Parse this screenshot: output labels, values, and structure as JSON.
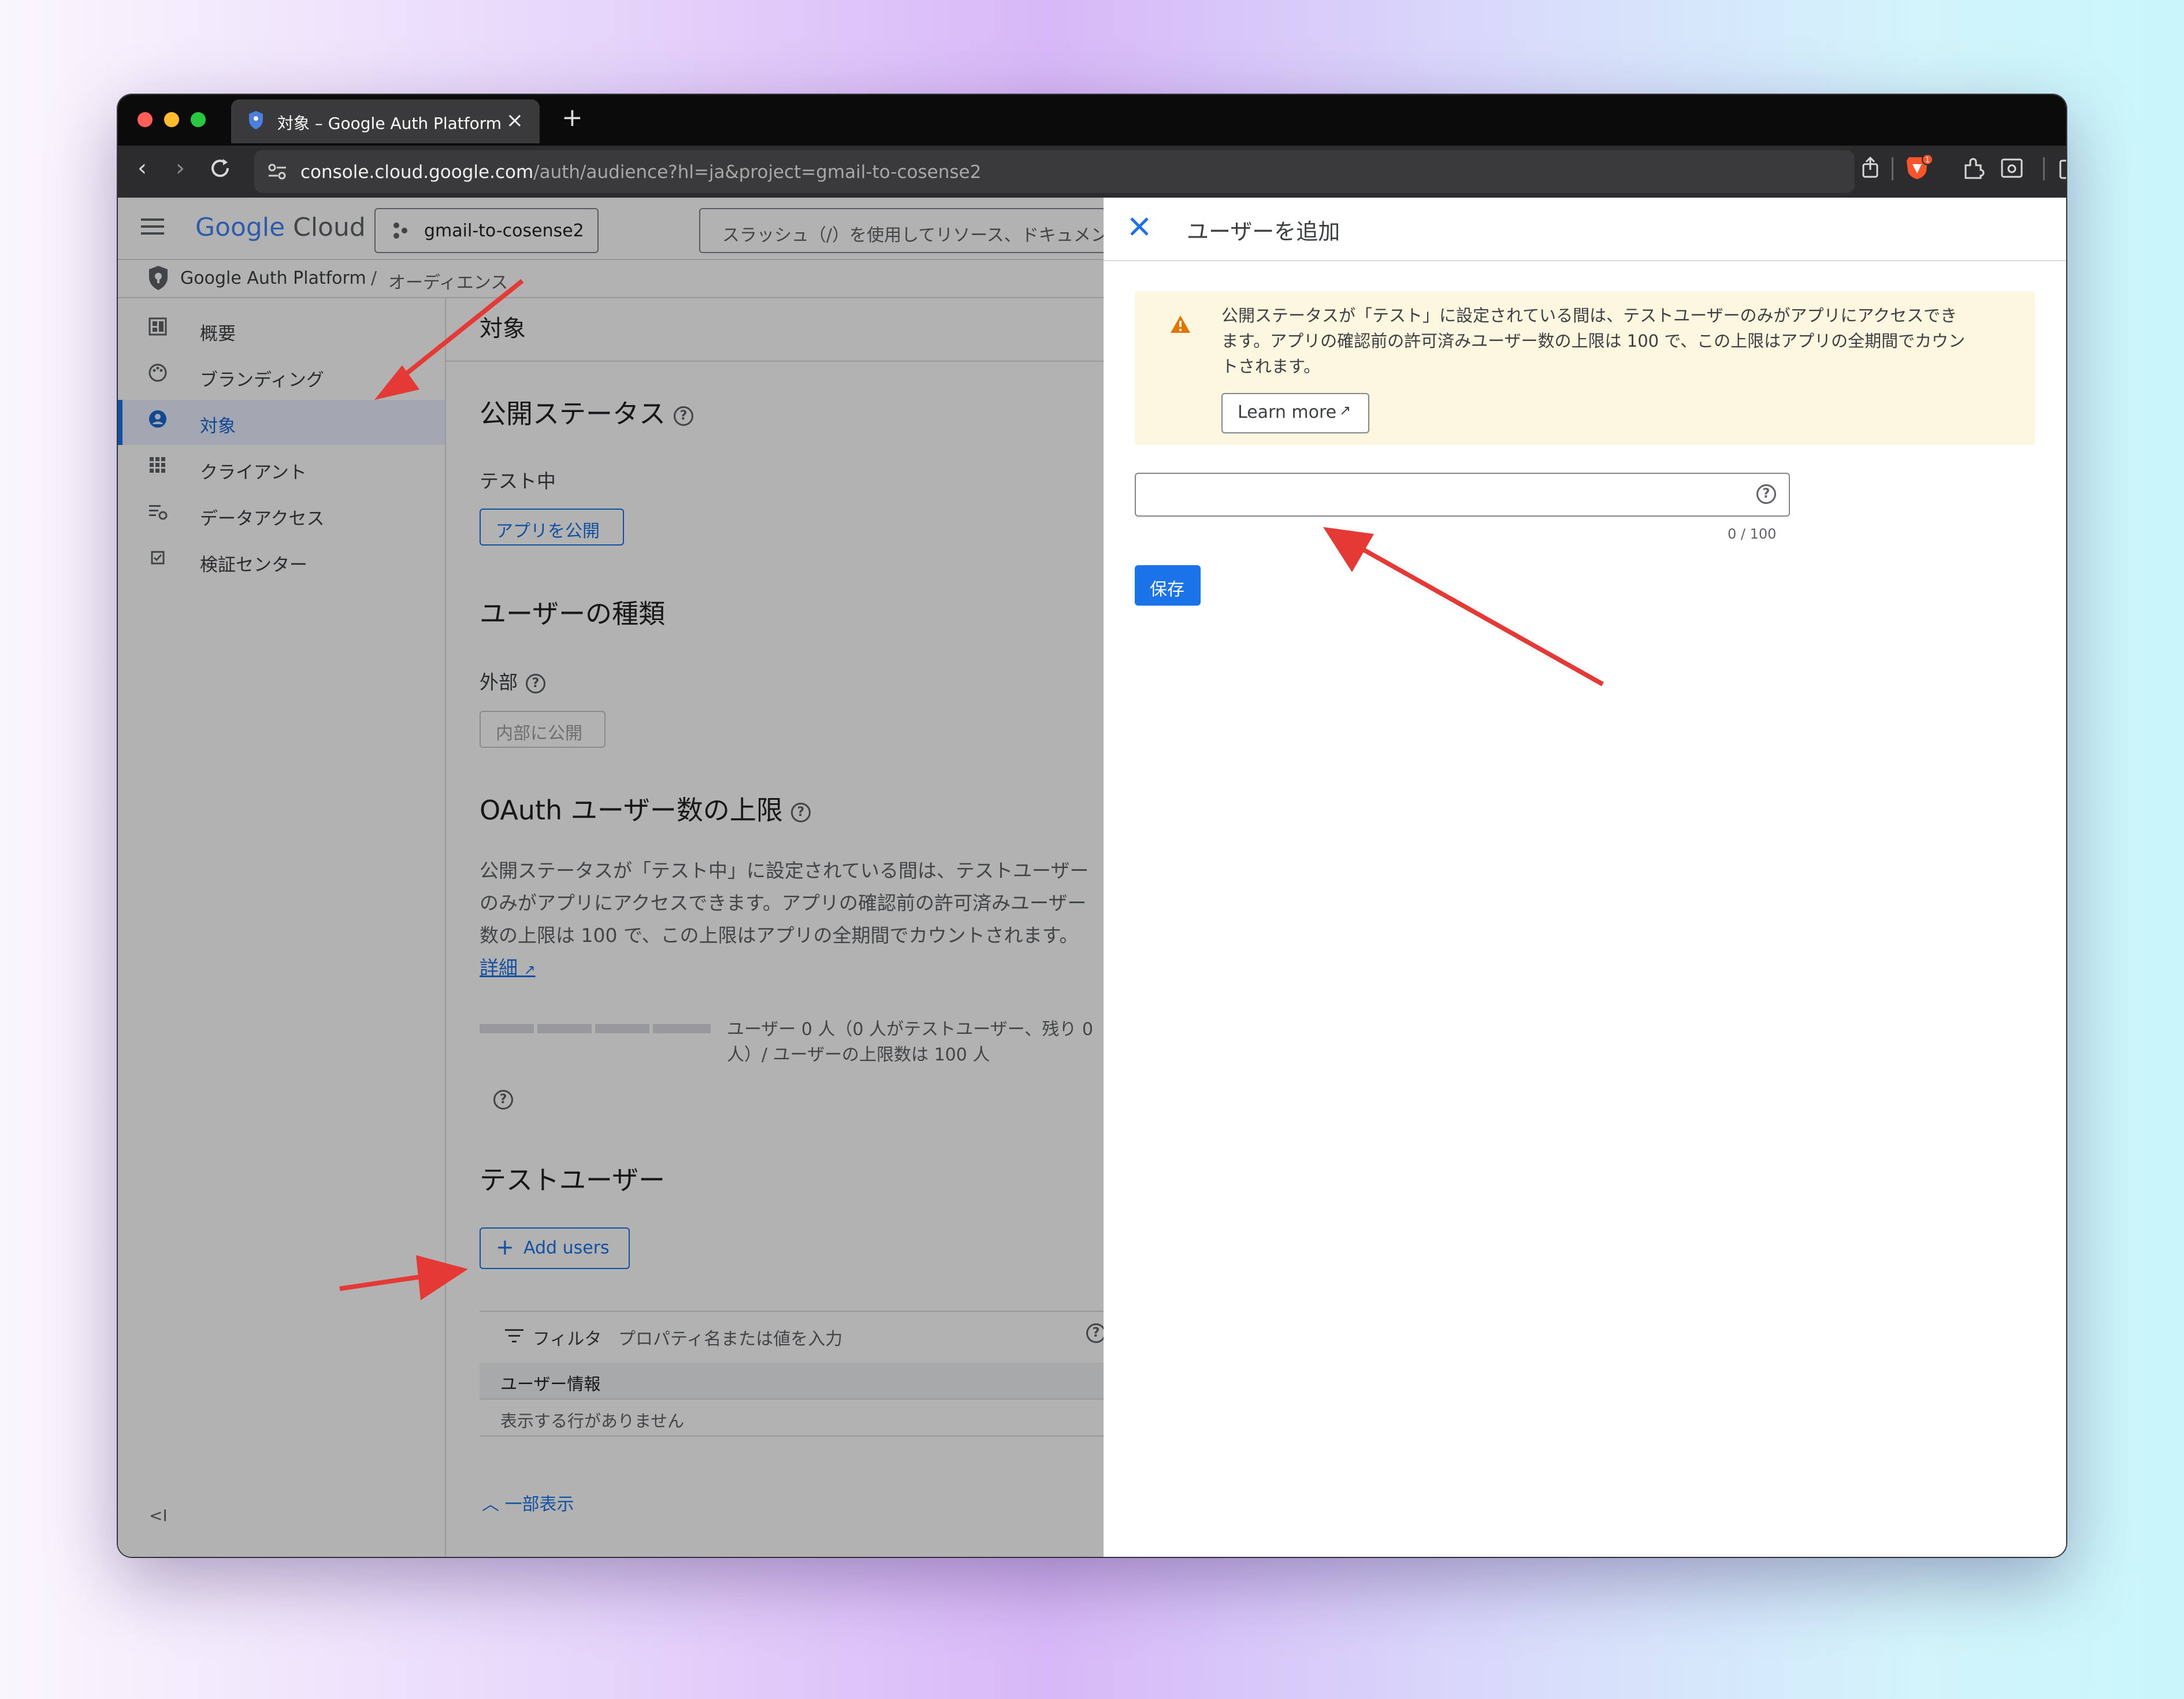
{
  "tab": {
    "title": "対象 – Google Auth Platform – Google Cloud"
  },
  "address": {
    "domain": "console.cloud.google.com",
    "path": "/auth/audience?hl=ja&project=gmail-to-cosense2"
  },
  "header": {
    "logo_google": "Google",
    "logo_cloud": "Cloud",
    "project": "gmail-to-cosense2",
    "search_placeholder": "スラッシュ（/）を使用してリソース、ドキュメント"
  },
  "breadcrumb": {
    "root": "Google Auth Platform",
    "sep": "/",
    "current": "オーディエンス"
  },
  "sidebar": {
    "items": [
      {
        "label": "概要",
        "icon": "dashboard-icon"
      },
      {
        "label": "ブランディング",
        "icon": "palette-icon"
      },
      {
        "label": "対象",
        "icon": "person-circle-icon"
      },
      {
        "label": "クライアント",
        "icon": "apps-grid-icon"
      },
      {
        "label": "データアクセス",
        "icon": "filter-settings-icon"
      },
      {
        "label": "検証センター",
        "icon": "checkbox-icon"
      }
    ],
    "active_index": 2,
    "collapse": "<I"
  },
  "main": {
    "title": "対象",
    "publish_status": {
      "heading": "公開ステータス",
      "value": "テスト中",
      "button": "アプリを公開"
    },
    "user_type": {
      "heading": "ユーザーの種類",
      "value": "外部",
      "button": "内部に公開"
    },
    "oauth_limit": {
      "heading": "OAuth ユーザー数の上限",
      "line1": "公開ステータスが「テスト中」に設定されている間は、テストユーザー",
      "line2": "のみがアプリにアクセスできます。アプリの確認前の許可済みユーザー",
      "line3": "数の上限は 100 で、この上限はアプリの全期間でカウントされます。",
      "link": "詳細",
      "usage_line1": "ユーザー 0 人（0 人がテストユーザー、残り 0",
      "usage_line2": "人）/ ユーザーの上限数は 100 人"
    },
    "test_users": {
      "heading": "テストユーザー",
      "add_button": "Add users",
      "filter_label": "フィルタ",
      "filter_placeholder": "プロパティ名または値を入力",
      "column": "ユーザー情報",
      "empty": "表示する行がありません"
    },
    "show_less": "一部表示"
  },
  "panel": {
    "title": "ユーザーを追加",
    "warning_line1": "公開ステータスが「テスト」に設定されている間は、テストユーザーのみがアプリにアクセスでき",
    "warning_line2": "ます。アプリの確認前の許可済みユーザー数の上限は 100 で、この上限はアプリの全期間でカウン",
    "warning_line3": "トされます。",
    "learn_more": "Learn more",
    "input_value": "",
    "counter": "0 / 100",
    "save": "保存"
  },
  "colors": {
    "accent": "#1a73e8",
    "warning_bg": "#fef7e0",
    "warning_icon": "#e37400",
    "arrow": "#e53935"
  }
}
